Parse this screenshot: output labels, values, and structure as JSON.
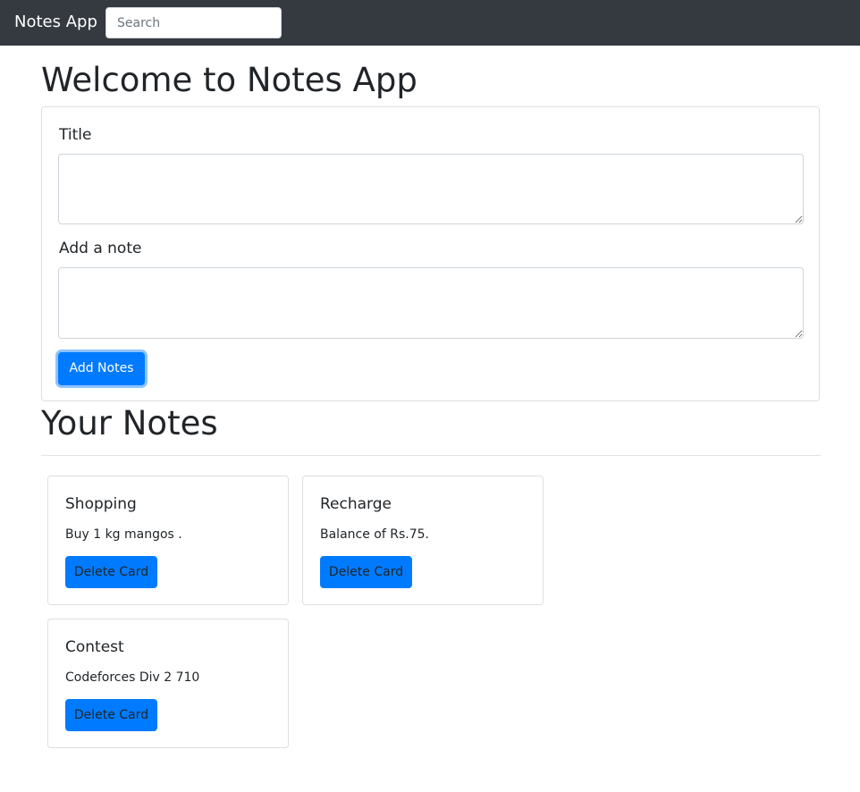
{
  "navbar": {
    "brand": "Notes App",
    "search_placeholder": "Search"
  },
  "page": {
    "welcome_heading": "Welcome to Notes App",
    "notes_heading": "Your Notes"
  },
  "form": {
    "title_label": "Title",
    "title_value": "",
    "note_label": "Add a note",
    "note_value": "",
    "add_button": "Add Notes"
  },
  "notes": [
    {
      "title": "Shopping",
      "text": "Buy 1 kg mangos .",
      "delete_label": "Delete Card"
    },
    {
      "title": "Recharge",
      "text": "Balance of Rs.75.",
      "delete_label": "Delete Card"
    },
    {
      "title": "Contest",
      "text": "Codeforces Div 2 710",
      "delete_label": "Delete Card"
    }
  ],
  "colors": {
    "navbar_bg": "#343a40",
    "primary": "#007bff",
    "border": "#dfdfdf"
  }
}
